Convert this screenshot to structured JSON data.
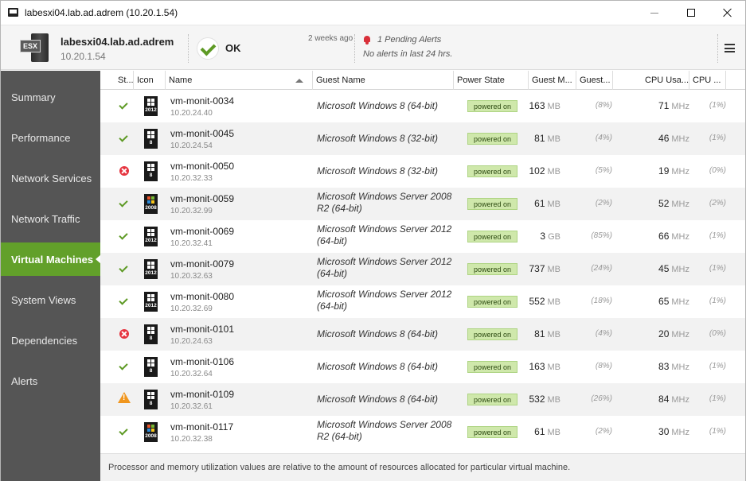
{
  "window": {
    "title": "labesxi04.lab.ad.adrem (10.20.1.54)"
  },
  "header": {
    "host_name": "labesxi04.lab.ad.adrem",
    "host_ip": "10.20.1.54",
    "host_badge": "ESX",
    "status": "OK",
    "status_age": "2 weeks ago",
    "pending_alerts": "1 Pending Alerts",
    "alerts_24h": "No alerts in last 24 hrs."
  },
  "sidebar": {
    "items": [
      {
        "label": "Summary",
        "active": false
      },
      {
        "label": "Performance",
        "active": false
      },
      {
        "label": "Network Services",
        "active": false
      },
      {
        "label": "Network Traffic",
        "active": false
      },
      {
        "label": "Virtual Machines",
        "active": true
      },
      {
        "label": "System Views",
        "active": false
      },
      {
        "label": "Dependencies",
        "active": false
      },
      {
        "label": "Alerts",
        "active": false
      }
    ]
  },
  "table": {
    "columns": [
      "St...",
      "Icon",
      "Name",
      "Guest Name",
      "Power State",
      "Guest M...",
      "Guest...",
      "CPU Usa...",
      "CPU ..."
    ],
    "rows": [
      {
        "status": "ok",
        "os": "win8",
        "os_ver": "2012",
        "name": "vm-monit-0034",
        "ip": "10.20.24.40",
        "guest": "Microsoft Windows 8 (64-bit)",
        "power": "powered on",
        "mem": "163",
        "mem_unit": "MB",
        "mem_pct": "(8%)",
        "cpu": "71",
        "cpu_unit": "MHz",
        "cpu_pct": "(1%)"
      },
      {
        "status": "ok",
        "os": "win8",
        "os_ver": "8",
        "name": "vm-monit-0045",
        "ip": "10.20.24.54",
        "guest": "Microsoft Windows 8 (32-bit)",
        "power": "powered on",
        "mem": "81",
        "mem_unit": "MB",
        "mem_pct": "(4%)",
        "cpu": "46",
        "cpu_unit": "MHz",
        "cpu_pct": "(1%)"
      },
      {
        "status": "error",
        "os": "win8",
        "os_ver": "8",
        "name": "vm-monit-0050",
        "ip": "10.20.32.33",
        "guest": "Microsoft Windows 8 (32-bit)",
        "power": "powered on",
        "mem": "102",
        "mem_unit": "MB",
        "mem_pct": "(5%)",
        "cpu": "19",
        "cpu_unit": "MHz",
        "cpu_pct": "(0%)"
      },
      {
        "status": "ok",
        "os": "xp",
        "os_ver": "2008",
        "name": "vm-monit-0059",
        "ip": "10.20.32.99",
        "guest": "Microsoft Windows Server 2008 R2 (64-bit)",
        "power": "powered on",
        "mem": "61",
        "mem_unit": "MB",
        "mem_pct": "(2%)",
        "cpu": "52",
        "cpu_unit": "MHz",
        "cpu_pct": "(2%)"
      },
      {
        "status": "ok",
        "os": "win8",
        "os_ver": "2012",
        "name": "vm-monit-0069",
        "ip": "10.20.32.41",
        "guest": "Microsoft Windows Server 2012 (64-bit)",
        "power": "powered on",
        "mem": "3",
        "mem_unit": "GB",
        "mem_pct": "(85%)",
        "cpu": "66",
        "cpu_unit": "MHz",
        "cpu_pct": "(1%)"
      },
      {
        "status": "ok",
        "os": "win8",
        "os_ver": "2012",
        "name": "vm-monit-0079",
        "ip": "10.20.32.63",
        "guest": "Microsoft Windows Server 2012 (64-bit)",
        "power": "powered on",
        "mem": "737",
        "mem_unit": "MB",
        "mem_pct": "(24%)",
        "cpu": "45",
        "cpu_unit": "MHz",
        "cpu_pct": "(1%)"
      },
      {
        "status": "ok",
        "os": "win8",
        "os_ver": "2012",
        "name": "vm-monit-0080",
        "ip": "10.20.32.69",
        "guest": "Microsoft Windows Server 2012 (64-bit)",
        "power": "powered on",
        "mem": "552",
        "mem_unit": "MB",
        "mem_pct": "(18%)",
        "cpu": "65",
        "cpu_unit": "MHz",
        "cpu_pct": "(1%)"
      },
      {
        "status": "error",
        "os": "win8",
        "os_ver": "8",
        "name": "vm-monit-0101",
        "ip": "10.20.24.63",
        "guest": "Microsoft Windows 8 (64-bit)",
        "power": "powered on",
        "mem": "81",
        "mem_unit": "MB",
        "mem_pct": "(4%)",
        "cpu": "20",
        "cpu_unit": "MHz",
        "cpu_pct": "(0%)"
      },
      {
        "status": "ok",
        "os": "win8",
        "os_ver": "8",
        "name": "vm-monit-0106",
        "ip": "10.20.32.64",
        "guest": "Microsoft Windows 8 (64-bit)",
        "power": "powered on",
        "mem": "163",
        "mem_unit": "MB",
        "mem_pct": "(8%)",
        "cpu": "83",
        "cpu_unit": "MHz",
        "cpu_pct": "(1%)"
      },
      {
        "status": "warning",
        "os": "win8",
        "os_ver": "8",
        "name": "vm-monit-0109",
        "ip": "10.20.32.61",
        "guest": "Microsoft Windows 8 (64-bit)",
        "power": "powered on",
        "mem": "532",
        "mem_unit": "MB",
        "mem_pct": "(26%)",
        "cpu": "84",
        "cpu_unit": "MHz",
        "cpu_pct": "(1%)"
      },
      {
        "status": "ok",
        "os": "xp",
        "os_ver": "2008",
        "name": "vm-monit-0117",
        "ip": "10.20.32.38",
        "guest": "Microsoft Windows Server 2008 R2 (64-bit)",
        "power": "powered on",
        "mem": "61",
        "mem_unit": "MB",
        "mem_pct": "(2%)",
        "cpu": "30",
        "cpu_unit": "MHz",
        "cpu_pct": "(1%)"
      }
    ]
  },
  "footer": {
    "note": "Processor and memory utilization values are relative to the amount of resources allocated for particular virtual machine."
  },
  "colors": {
    "accent": "#62a02a",
    "sidebar": "#555555",
    "error": "#e63540",
    "warning": "#f0961e",
    "power_badge": "#cfe8ab"
  }
}
